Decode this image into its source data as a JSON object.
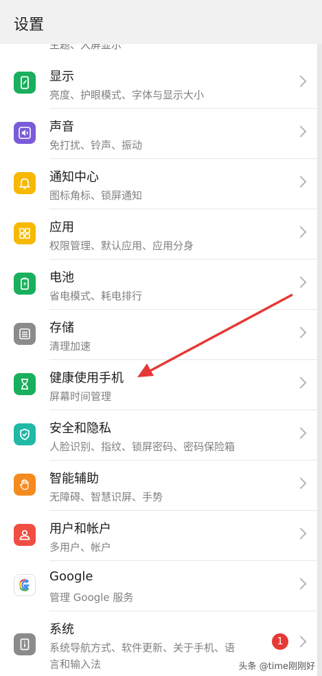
{
  "header": {
    "title": "设置"
  },
  "partial_item_text": "主题、大屏显示",
  "items": [
    {
      "title": "显示",
      "subtitle": "亮度、护眼模式、字体与显示大小",
      "icon": "display-icon",
      "color": "#1aaf5d"
    },
    {
      "title": "声音",
      "subtitle": "免打扰、铃声、振动",
      "icon": "sound-icon",
      "color": "#7a5cd8"
    },
    {
      "title": "通知中心",
      "subtitle": "图标角标、锁屏通知",
      "icon": "bell-icon",
      "color": "#f6b900"
    },
    {
      "title": "应用",
      "subtitle": "权限管理、默认应用、应用分身",
      "icon": "apps-icon",
      "color": "#f6b900"
    },
    {
      "title": "电池",
      "subtitle": "省电模式、耗电排行",
      "icon": "battery-icon",
      "color": "#1aaf5d"
    },
    {
      "title": "存储",
      "subtitle": "清理加速",
      "icon": "storage-icon",
      "color": "#8b8b8b"
    },
    {
      "title": "健康使用手机",
      "subtitle": "屏幕时间管理",
      "icon": "hourglass-icon",
      "color": "#1aaf5d"
    },
    {
      "title": "安全和隐私",
      "subtitle": "人脸识别、指纹、锁屏密码、密码保险箱",
      "icon": "shield-icon",
      "color": "#20b9a7"
    },
    {
      "title": "智能辅助",
      "subtitle": "无障碍、智慧识屏、手势",
      "icon": "hand-icon",
      "color": "#f58a1f"
    },
    {
      "title": "用户和帐户",
      "subtitle": "多用户、帐户",
      "icon": "user-icon",
      "color": "#f04e43"
    },
    {
      "title": "Google",
      "subtitle": "管理 Google 服务",
      "icon": "google-icon",
      "color": "#ffffff"
    },
    {
      "title": "系统",
      "subtitle": "系统导航方式、软件更新、关于手机、语",
      "subtitle2": "言和输入法",
      "icon": "system-icon",
      "color": "#8b8b8b",
      "badge": "1"
    }
  ],
  "watermark": "头条 @time刚刚好",
  "colors": {
    "annotation_arrow": "#e53935"
  }
}
